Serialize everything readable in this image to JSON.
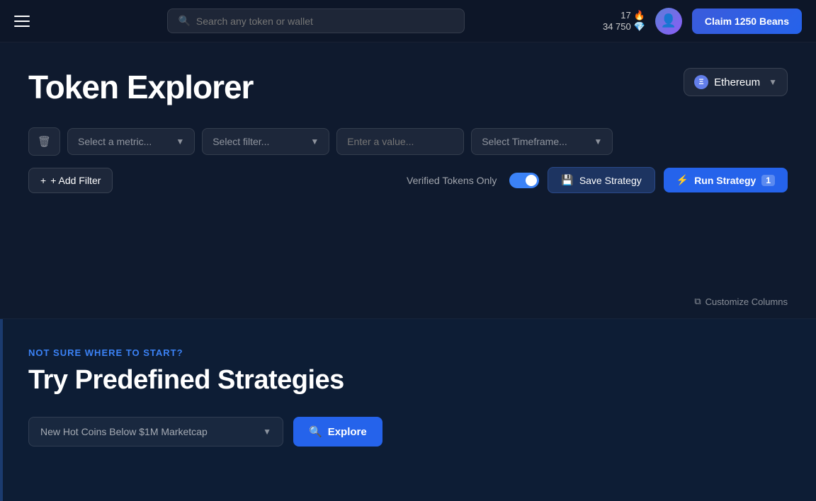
{
  "header": {
    "search_placeholder": "Search any token or wallet",
    "stats": {
      "count": "17",
      "amount": "34 750"
    },
    "claim_label": "Claim 1250 Beans"
  },
  "page": {
    "title": "Token Explorer",
    "network": {
      "label": "Ethereum",
      "symbol": "Ξ"
    }
  },
  "filters": {
    "trash_icon": "🗑",
    "metric_placeholder": "Select a metric...",
    "filter_placeholder": "Select filter...",
    "value_placeholder": "Enter a value...",
    "timeframe_placeholder": "Select Timeframe..."
  },
  "actions": {
    "add_filter_label": "+ Add Filter",
    "verified_label": "Verified Tokens Only",
    "save_strategy_label": "Save Strategy",
    "run_strategy_label": "Run Strategy",
    "run_strategy_count": "1",
    "customize_label": "Customize Columns"
  },
  "lower": {
    "subtitle": "NOT SURE WHERE TO START?",
    "title": "Try Predefined Strategies",
    "strategy_placeholder": "New Hot Coins Below $1M Marketcap",
    "explore_label": "Explore"
  },
  "icons": {
    "search": "⌕",
    "hamburger": "☰",
    "save": "💾",
    "filter": "⚡",
    "external": "⧉",
    "search_explore": "🔍"
  }
}
